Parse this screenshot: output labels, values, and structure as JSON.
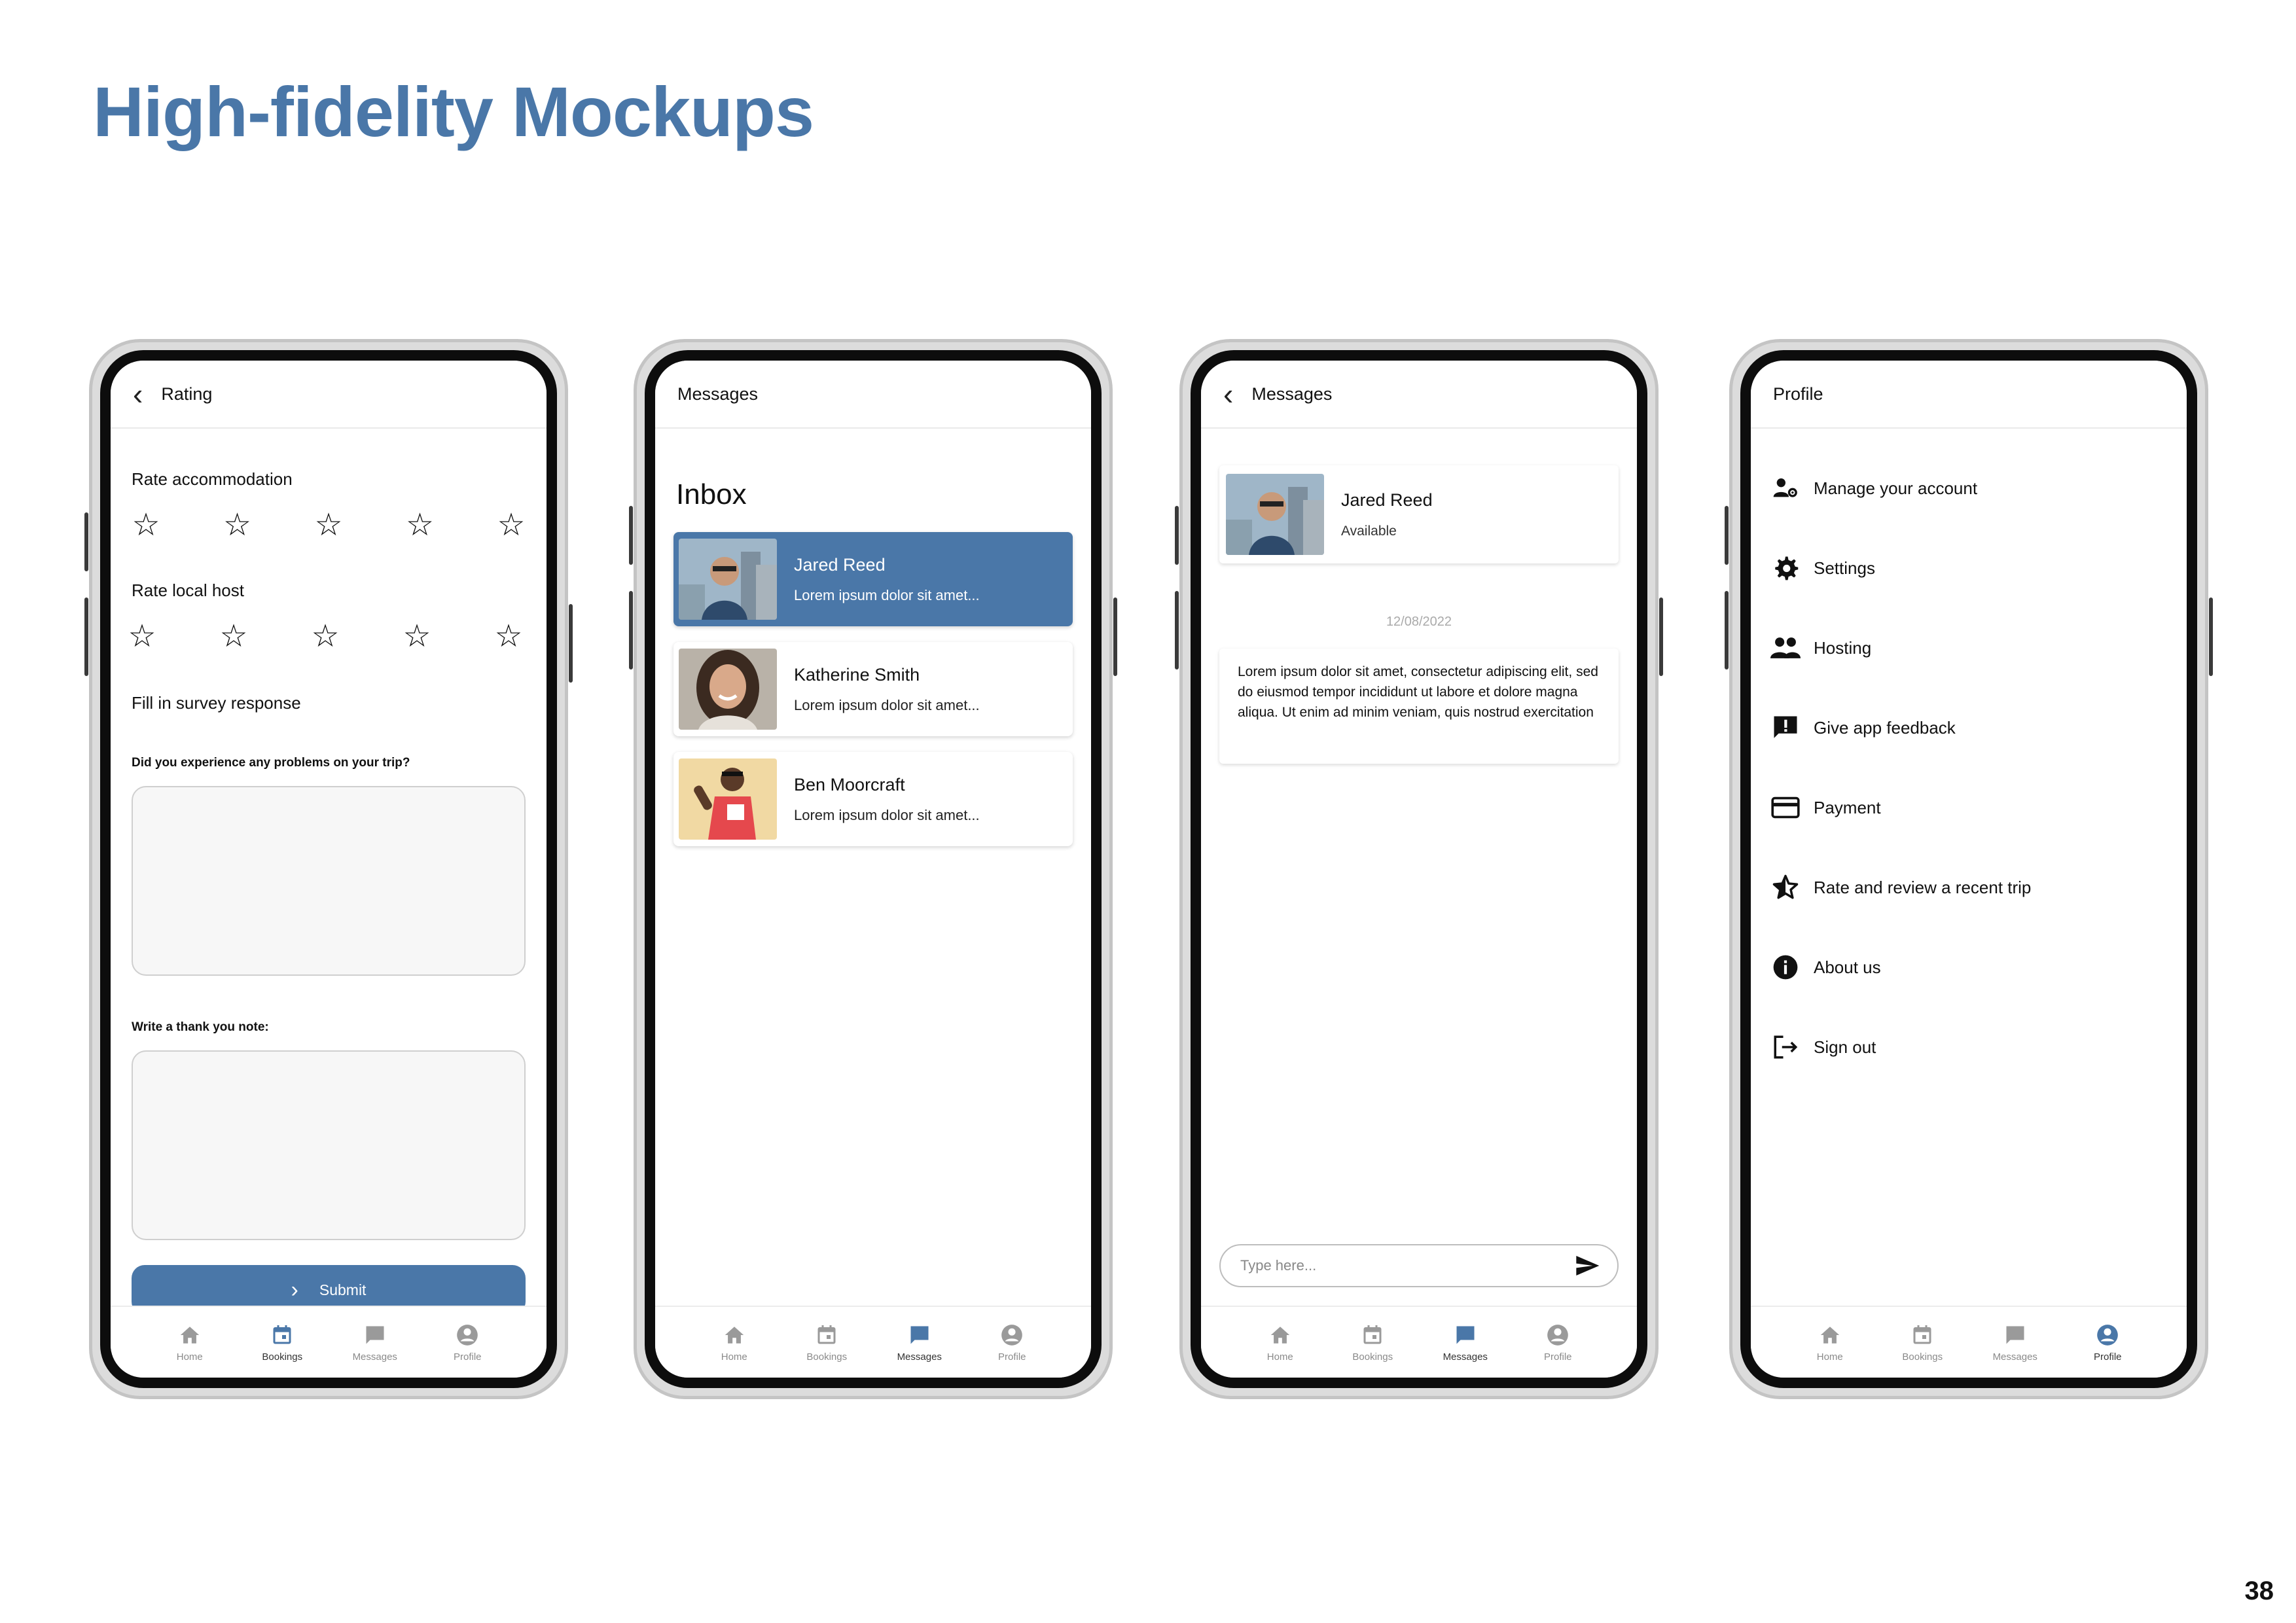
{
  "slide": {
    "title": "High-fidelity Mockups",
    "page_number": "38"
  },
  "colors": {
    "accent": "#4a77a8",
    "text": "#111111",
    "muted_nav": "#8a8a8a"
  },
  "nav": {
    "home": "Home",
    "bookings": "Bookings",
    "messages": "Messages",
    "profile": "Profile"
  },
  "rating_screen": {
    "title": "Rating",
    "rate_accommodation": "Rate accommodation",
    "rate_local_host": "Rate local host",
    "star_glyph": "☆",
    "accommodation_rating": 0,
    "host_rating": 0,
    "fill_survey": "Fill in survey response",
    "question_problems": "Did you experience any problems on your trip?",
    "question_thanks": "Write a thank you note:",
    "submit": "Submit",
    "active_tab": "bookings"
  },
  "messages_screen": {
    "title": "Messages",
    "heading": "Inbox",
    "conversations": [
      {
        "name": "Jared Reed",
        "preview": "Lorem ipsum dolor sit amet...",
        "selected": true
      },
      {
        "name": "Katherine Smith",
        "preview": "Lorem ipsum dolor sit amet...",
        "selected": false
      },
      {
        "name": "Ben Moorcraft",
        "preview": "Lorem ipsum dolor sit amet...",
        "selected": false
      }
    ],
    "active_tab": "messages"
  },
  "chat_screen": {
    "title": "Messages",
    "contact_name": "Jared Reed",
    "contact_status": "Available",
    "date": "12/08/2022",
    "message": "Lorem ipsum dolor sit amet, consectetur adipiscing elit, sed do eiusmod tempor incididunt ut labore et dolore magna aliqua. Ut enim ad minim veniam, quis nostrud exercitation",
    "input_placeholder": "Type here...",
    "active_tab": "messages"
  },
  "profile_screen": {
    "title": "Profile",
    "items": [
      {
        "label": "Manage your account",
        "icon": "manage-account-icon"
      },
      {
        "label": "Settings",
        "icon": "gear-icon"
      },
      {
        "label": "Hosting",
        "icon": "people-icon"
      },
      {
        "label": "Give app feedback",
        "icon": "feedback-icon"
      },
      {
        "label": "Payment",
        "icon": "credit-card-icon"
      },
      {
        "label": "Rate and review a recent trip",
        "icon": "star-icon"
      },
      {
        "label": "About us",
        "icon": "info-icon"
      },
      {
        "label": "Sign out",
        "icon": "sign-out-icon"
      }
    ],
    "active_tab": "profile"
  }
}
